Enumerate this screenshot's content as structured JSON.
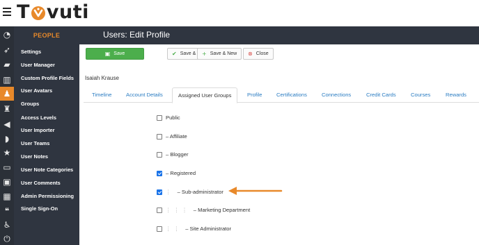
{
  "brand": {
    "name_left": "T",
    "name_right": "vuti",
    "logo_icon": "tovuti-logo-icon",
    "accent": "#e8892a"
  },
  "rail_icons": [
    "dashboard-icon",
    "rocket-icon",
    "graduation-cap-icon",
    "chart-icon",
    "users-icon",
    "trophy-icon",
    "megaphone-icon",
    "feed-icon",
    "star-icon",
    "credit-card-icon",
    "badge-icon",
    "calculator-icon",
    "comments-icon",
    "accessibility-icon",
    "power-icon"
  ],
  "sidebar": {
    "heading": "PEOPLE",
    "items": [
      {
        "label": "Settings"
      },
      {
        "label": "User Manager"
      },
      {
        "label": "Custom Profile Fields"
      },
      {
        "label": "User Avatars"
      },
      {
        "label": "Groups"
      },
      {
        "label": "Access Levels"
      },
      {
        "label": "User Importer"
      },
      {
        "label": "User Teams"
      },
      {
        "label": "User Notes"
      },
      {
        "label": "User Note Categories"
      },
      {
        "label": "User Comments"
      },
      {
        "label": "Admin Permissioning"
      },
      {
        "label": "Single Sign-On"
      }
    ]
  },
  "page": {
    "title": "Users: Edit Profile"
  },
  "toolbar": {
    "save": "Save",
    "save_close": "Save & Close",
    "save_new": "Save & New",
    "close": "Close"
  },
  "user_name": "Isaiah Krause",
  "tabs": [
    {
      "label": "Timeline"
    },
    {
      "label": "Account Details"
    },
    {
      "label": "Assigned User Groups",
      "active": true
    },
    {
      "label": "Profile"
    },
    {
      "label": "Certifications"
    },
    {
      "label": "Connections"
    },
    {
      "label": "Credit Cards"
    },
    {
      "label": "Courses"
    },
    {
      "label": "Rewards"
    }
  ],
  "groups": [
    {
      "label": "Public",
      "checked": false
    },
    {
      "label": "– Affiliate",
      "checked": false
    },
    {
      "label": "– Blogger",
      "checked": false
    },
    {
      "label": "– Registered",
      "checked": true
    },
    {
      "label": "– Sub-administrator",
      "checked": true
    },
    {
      "label": "– Marketing Department",
      "checked": false
    },
    {
      "label": "– Site Administrator",
      "checked": false
    }
  ],
  "annotation": {
    "icon": "arrow-left-icon",
    "color": "#e8892a"
  }
}
